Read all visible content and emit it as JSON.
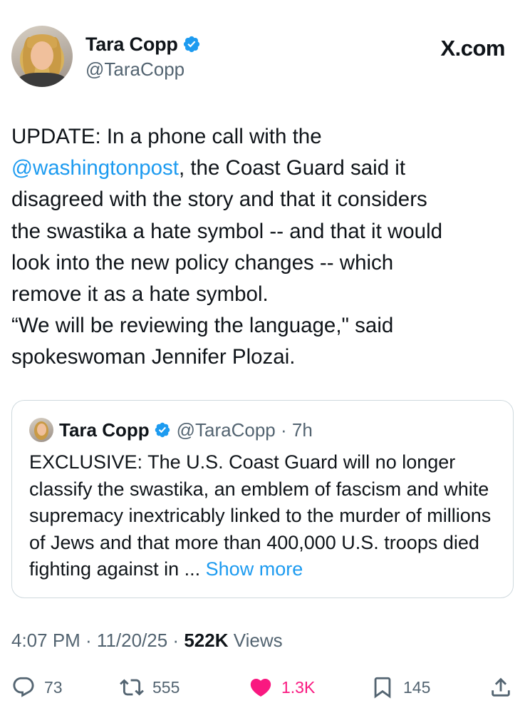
{
  "header": {
    "name": "Tara Copp",
    "handle": "@TaraCopp",
    "site": "X.com",
    "verified_color": "#1d9bf0"
  },
  "tweet": {
    "text_before_mention": "UPDATE: In a phone call with the\n",
    "mention": "@washingtonpost",
    "text_after_mention": ", the Coast Guard said it\ndisagreed with the story and that it considers\nthe swastika a hate symbol -- and that it   would\nlook into the new policy changes -- which\nremove it as a hate symbol.\n“We will be reviewing the language,\" said\nspokeswoman Jennifer Plozai."
  },
  "quote": {
    "name": "Tara Copp",
    "handle_time": "@TaraCopp · 7h",
    "text": "EXCLUSIVE: The U.S. Coast Guard will no longer classify the swastika, an emblem of fascism and white supremacy inextricably linked to the murder of millions of Jews and that more than 400,000 U.S. troops died fighting against in ... ",
    "show_more": "Show more"
  },
  "meta": {
    "time": "4:07 PM · 11/20/25 · ",
    "views_count": "522K",
    "views_label": " Views"
  },
  "actions": {
    "replies": "73",
    "reposts": "555",
    "likes": "1.3K",
    "bookmarks": "145",
    "like_color": "#f91880",
    "icons": [
      "reply-icon",
      "repost-icon",
      "heart-icon",
      "bookmark-icon",
      "share-icon"
    ]
  }
}
